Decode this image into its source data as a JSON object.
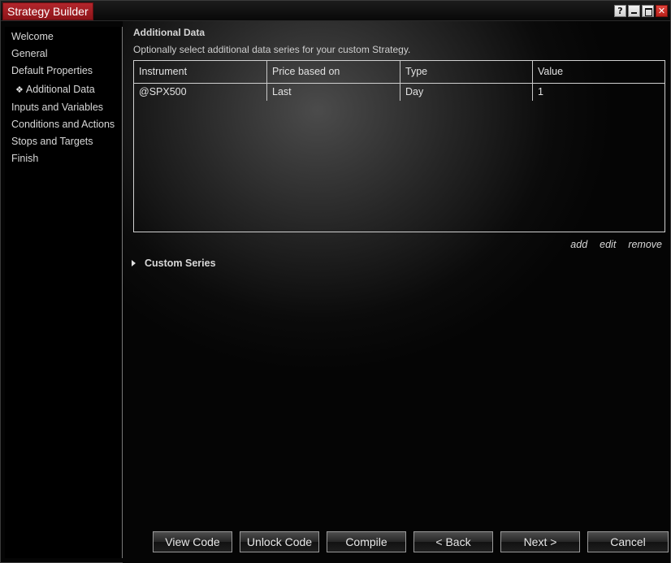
{
  "window": {
    "title": "Strategy Builder",
    "controls": {
      "help": "?",
      "minimize": "",
      "maximize": "",
      "close": "✕"
    },
    "accent_color": "#a11c22"
  },
  "sidebar": {
    "items": [
      {
        "label": "Welcome",
        "active": false
      },
      {
        "label": "General",
        "active": false
      },
      {
        "label": "Default Properties",
        "active": false
      },
      {
        "label": "Additional Data",
        "active": true
      },
      {
        "label": "Inputs and Variables",
        "active": false
      },
      {
        "label": "Conditions and Actions",
        "active": false
      },
      {
        "label": "Stops and Targets",
        "active": false
      },
      {
        "label": "Finish",
        "active": false
      }
    ],
    "active_marker": "❖"
  },
  "main": {
    "title": "Additional Data",
    "description": "Optionally select additional data series for your custom Strategy.",
    "grid": {
      "columns": [
        "Instrument",
        "Price based on",
        "Type",
        "Value"
      ],
      "rows": [
        [
          "@SPX500",
          "Last",
          "Day",
          "1"
        ]
      ]
    },
    "grid_actions": {
      "add": "add",
      "edit": "edit",
      "remove": "remove"
    },
    "custom_series": {
      "label": "Custom Series",
      "expanded": false
    }
  },
  "footer": {
    "view_code": "View Code",
    "unlock_code": "Unlock Code",
    "compile": "Compile",
    "back": "< Back",
    "next": "Next >",
    "cancel": "Cancel"
  }
}
